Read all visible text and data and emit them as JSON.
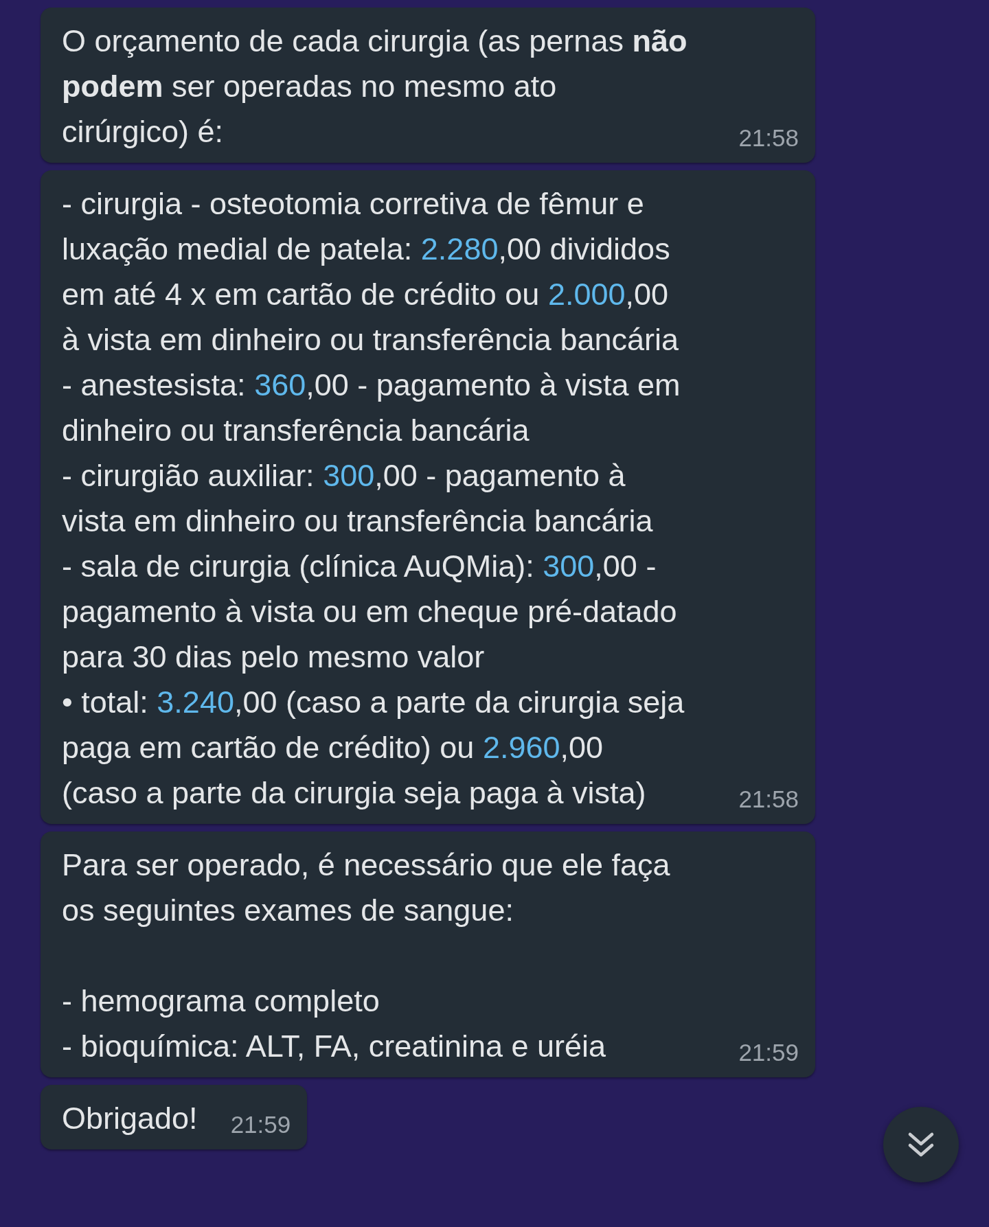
{
  "messages": [
    {
      "time": "21:58",
      "lines": [
        {
          "kind": "text",
          "segments": [
            {
              "kind": "text",
              "text": "O orçamento de cada cirurgia (as pernas "
            },
            {
              "kind": "bold",
              "text": "não"
            }
          ]
        },
        {
          "kind": "text",
          "segments": [
            {
              "kind": "bold",
              "text": "podem"
            },
            {
              "kind": "text",
              "text": " ser operadas no mesmo ato"
            }
          ]
        },
        {
          "kind": "text",
          "segments": [
            {
              "kind": "text",
              "text": "cirúrgico) é:"
            }
          ]
        }
      ]
    },
    {
      "time": "21:58",
      "lines": [
        {
          "kind": "text",
          "segments": [
            {
              "kind": "text",
              "text": "- cirurgia - osteotomia corretiva de fêmur e"
            }
          ]
        },
        {
          "kind": "text",
          "segments": [
            {
              "kind": "text",
              "text": "luxação medial de patela: "
            },
            {
              "kind": "link",
              "text": "2.280"
            },
            {
              "kind": "text",
              "text": ",00 divididos"
            }
          ]
        },
        {
          "kind": "text",
          "segments": [
            {
              "kind": "text",
              "text": "em até 4 x em cartão de crédito ou "
            },
            {
              "kind": "link",
              "text": "2.000"
            },
            {
              "kind": "text",
              "text": ",00"
            }
          ]
        },
        {
          "kind": "text",
          "segments": [
            {
              "kind": "text",
              "text": "à vista em dinheiro ou transferência bancária"
            }
          ]
        },
        {
          "kind": "text",
          "segments": [
            {
              "kind": "text",
              "text": "- anestesista: "
            },
            {
              "kind": "link",
              "text": "360"
            },
            {
              "kind": "text",
              "text": ",00 - pagamento à vista em"
            }
          ]
        },
        {
          "kind": "text",
          "segments": [
            {
              "kind": "text",
              "text": "dinheiro ou transferência bancária"
            }
          ]
        },
        {
          "kind": "text",
          "segments": [
            {
              "kind": "text",
              "text": "- cirurgião auxiliar: "
            },
            {
              "kind": "link",
              "text": "300"
            },
            {
              "kind": "text",
              "text": ",00 - pagamento à"
            }
          ]
        },
        {
          "kind": "text",
          "segments": [
            {
              "kind": "text",
              "text": "vista em dinheiro ou transferência bancária"
            }
          ]
        },
        {
          "kind": "text",
          "segments": [
            {
              "kind": "text",
              "text": "- sala de cirurgia (clínica AuQMia): "
            },
            {
              "kind": "link",
              "text": "300"
            },
            {
              "kind": "text",
              "text": ",00 -"
            }
          ]
        },
        {
          "kind": "text",
          "segments": [
            {
              "kind": "text",
              "text": "pagamento à vista ou em cheque pré-datado"
            }
          ]
        },
        {
          "kind": "text",
          "segments": [
            {
              "kind": "text",
              "text": "para 30 dias pelo mesmo valor"
            }
          ]
        },
        {
          "kind": "text",
          "segments": [
            {
              "kind": "text",
              "text": "• total: "
            },
            {
              "kind": "link",
              "text": "3.240"
            },
            {
              "kind": "text",
              "text": ",00 (caso a parte da cirurgia seja"
            }
          ]
        },
        {
          "kind": "text",
          "segments": [
            {
              "kind": "text",
              "text": "paga em cartão de crédito) ou "
            },
            {
              "kind": "link",
              "text": "2.960"
            },
            {
              "kind": "text",
              "text": ",00"
            }
          ]
        },
        {
          "kind": "text",
          "segments": [
            {
              "kind": "text",
              "text": "(caso a parte da cirurgia seja paga à vista)"
            }
          ]
        }
      ]
    },
    {
      "time": "21:59",
      "lines": [
        {
          "kind": "text",
          "segments": [
            {
              "kind": "text",
              "text": "Para ser operado, é necessário que ele faça"
            }
          ]
        },
        {
          "kind": "text",
          "segments": [
            {
              "kind": "text",
              "text": "os seguintes exames de sangue:"
            }
          ]
        },
        {
          "kind": "blank"
        },
        {
          "kind": "text",
          "segments": [
            {
              "kind": "text",
              "text": "- hemograma completo"
            }
          ]
        },
        {
          "kind": "text",
          "segments": [
            {
              "kind": "text",
              "text": "- bioquímica: ALT, FA, creatinina e uréia"
            }
          ]
        }
      ]
    },
    {
      "time": "21:59",
      "lines": [
        {
          "kind": "text",
          "segments": [
            {
              "kind": "text",
              "text": "Obrigado!"
            }
          ]
        }
      ]
    }
  ]
}
